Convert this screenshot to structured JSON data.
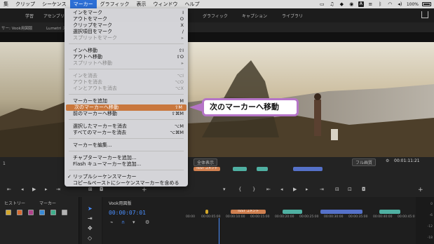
{
  "menubar": {
    "items": [
      "集",
      "クリップ",
      "シーケンス",
      "マーカー",
      "グラフィック",
      "表示",
      "ウィンドウ",
      "ヘルプ"
    ],
    "active_index": 3,
    "status": {
      "battery": "100%",
      "input_icon": "A",
      "menu_icon": "≡"
    }
  },
  "workspace": {
    "tabs": [
      "学習",
      "アセンブリ",
      "グラフィック",
      "キャプション",
      "ライブラリ"
    ]
  },
  "panels": {
    "source_header": "サー: Vook用図版",
    "lumetri_header": "Lumetri ス",
    "program_view": "全体表示",
    "quality": "フル画質",
    "program_timecode": "00:01:11:21",
    "timecode_left": "1",
    "marker_test": "TEST コメント"
  },
  "menu": {
    "items": [
      {
        "label": "インをマーク",
        "shortcut": "I",
        "disabled": false
      },
      {
        "label": "アウトをマーク",
        "shortcut": "O",
        "disabled": false
      },
      {
        "label": "クリップをマーク",
        "shortcut": "X",
        "disabled": false
      },
      {
        "label": "選択項目をマーク",
        "shortcut": "/",
        "disabled": false
      },
      {
        "label": "スプリットをマーク",
        "shortcut": "▸",
        "disabled": true
      },
      {
        "label": "インへ移動",
        "shortcut": "⇧I",
        "disabled": false
      },
      {
        "label": "アウトへ移動",
        "shortcut": "⇧O",
        "disabled": false
      },
      {
        "label": "スプリットへ移動",
        "shortcut": "▸",
        "disabled": true
      },
      {
        "label": "インを消去",
        "shortcut": "⌥I",
        "disabled": true
      },
      {
        "label": "アウトを消去",
        "shortcut": "⌥O",
        "disabled": true
      },
      {
        "label": "インとアウトを消去",
        "shortcut": "⌥X",
        "disabled": true
      },
      {
        "label": "マーカーを追加",
        "shortcut": "M",
        "disabled": false
      },
      {
        "label": "次のマーカーへ移動",
        "shortcut": "⇧M",
        "disabled": false,
        "highlighted": true
      },
      {
        "label": "前のマーカーへ移動",
        "shortcut": "⇧⌘M",
        "disabled": false
      },
      {
        "label": "選択したマーカーを消去",
        "shortcut": "⌥M",
        "disabled": false
      },
      {
        "label": "すべてのマーカーを消去",
        "shortcut": "⌥⌘M",
        "disabled": false
      },
      {
        "label": "マーカーを編集...",
        "shortcut": "",
        "disabled": false
      },
      {
        "label": "チャプターマーカーを追加...",
        "shortcut": "",
        "disabled": false
      },
      {
        "label": "Flash キューマーカーを追加...",
        "shortcut": "",
        "disabled": false
      },
      {
        "label": "リップルシーケンスマーカー",
        "shortcut": "",
        "disabled": false,
        "checked": true
      },
      {
        "label": "コピー&ペーストにシーケンスマーカーを含める",
        "shortcut": "",
        "disabled": false
      }
    ]
  },
  "callout": {
    "text": "次のマーカーへ移動"
  },
  "bottom": {
    "left_tabs": [
      "ヒストリー",
      "マーカー"
    ],
    "sequence_name": "Vook用図版",
    "timecode": "00:00:07:01",
    "ruler": [
      "00:00",
      "00:00:05:00",
      "00:00:10:00",
      "00:00:15:00",
      "00:00:20:00",
      "00:00:25:00",
      "00:00:30:00",
      "00:00:35:00",
      "00:00:40:00",
      "00:00:45:0"
    ],
    "meter_labels": [
      "0",
      "-6",
      "-12",
      "-18"
    ],
    "swatch_colors": [
      "#d4a82b",
      "#d66a30",
      "#b0418a",
      "#3a8bd6",
      "#3fae8c",
      "#b3b3b3"
    ]
  }
}
